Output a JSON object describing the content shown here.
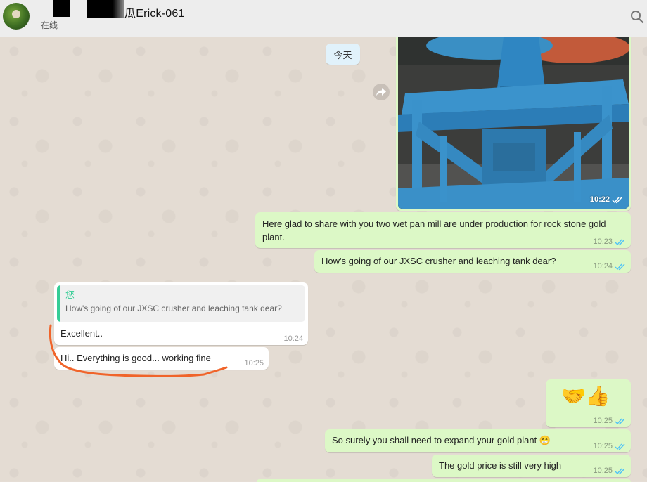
{
  "header": {
    "contact_name": "瓜Erick-061",
    "status": "在线",
    "icons": {
      "search": "search-icon",
      "avatar": "avatar"
    }
  },
  "chat": {
    "date_divider": "今天",
    "forward_icon": "forward-icon",
    "messages": [
      {
        "id": "m1",
        "direction": "out",
        "type": "image",
        "time": "10:22",
        "status": "read"
      },
      {
        "id": "m2",
        "direction": "out",
        "type": "text",
        "text": "Here glad to share with you two wet pan mill are under production for rock stone gold plant.",
        "time": "10:23",
        "status": "read"
      },
      {
        "id": "m3",
        "direction": "out",
        "type": "text",
        "text": "How's going of our JXSC crusher and leaching tank dear?",
        "time": "10:24",
        "status": "read"
      },
      {
        "id": "m4",
        "direction": "in",
        "type": "reply",
        "quote_author": "您",
        "quote_text": "How's going of our JXSC crusher and leaching tank dear?",
        "text": "Excellent..",
        "time": "10:24"
      },
      {
        "id": "m5",
        "direction": "in",
        "type": "text",
        "text": "Hi.. Everything is good... working fine",
        "time": "10:25"
      },
      {
        "id": "m6",
        "direction": "out",
        "type": "emoji",
        "text": "🤝👍",
        "time": "10:25",
        "status": "read"
      },
      {
        "id": "m7",
        "direction": "out",
        "type": "text",
        "text": "So surely you shall need to expand your gold plant 😁",
        "time": "10:25",
        "status": "read"
      },
      {
        "id": "m8",
        "direction": "out",
        "type": "text",
        "text": "The gold price is still very high",
        "time": "10:25",
        "status": "read"
      }
    ]
  },
  "colors": {
    "outgoing_bubble": "#dcf8c6",
    "incoming_bubble": "#ffffff",
    "read_tick": "#4fc3f7",
    "quote_accent": "#35cd96",
    "annotation_stroke": "#f0642a"
  }
}
